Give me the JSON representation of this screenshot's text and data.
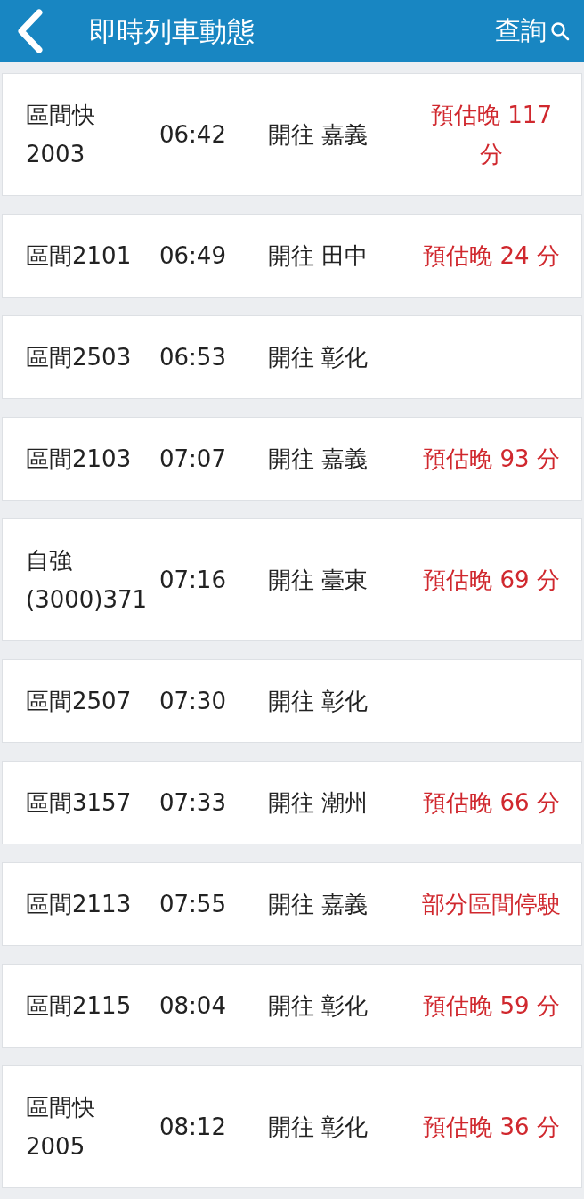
{
  "header": {
    "title": "即時列車動態",
    "action": "查詢"
  },
  "trains": [
    {
      "train": "區間快\n2003",
      "time": "06:42",
      "destination": "開往 嘉義",
      "status": "預估晚 117\n分"
    },
    {
      "train": "區間2101",
      "time": "06:49",
      "destination": "開往 田中",
      "status": "預估晚 24 分"
    },
    {
      "train": "區間2503",
      "time": "06:53",
      "destination": "開往 彰化"
    },
    {
      "train": "區間2103",
      "time": "07:07",
      "destination": "開往 嘉義",
      "status": "預估晚 93 分"
    },
    {
      "train": "自強\n(3000)371",
      "time": "07:16",
      "destination": "開往 臺東",
      "status": "預估晚 69 分"
    },
    {
      "train": "區間2507",
      "time": "07:30",
      "destination": "開往 彰化"
    },
    {
      "train": "區間3157",
      "time": "07:33",
      "destination": "開往 潮州",
      "status": "預估晚 66 分"
    },
    {
      "train": "區間2113",
      "time": "07:55",
      "destination": "開往 嘉義",
      "status": "部分區間停駛"
    },
    {
      "train": "區間2115",
      "time": "08:04",
      "destination": "開往 彰化",
      "status": "預估晚 59 分"
    },
    {
      "train": "區間快\n2005",
      "time": "08:12",
      "destination": "開往 彰化",
      "status": "預估晚 36 分"
    }
  ]
}
